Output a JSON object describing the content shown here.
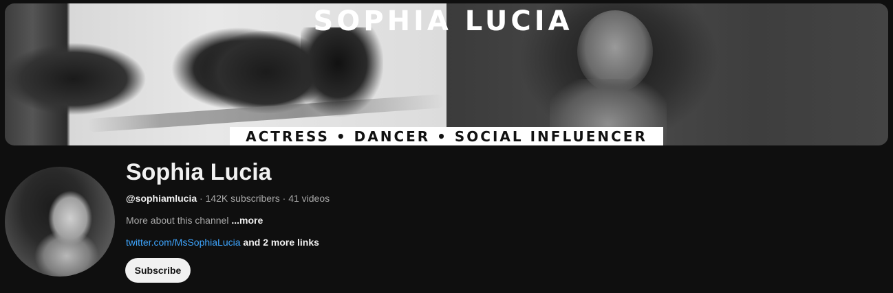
{
  "banner": {
    "title": "SOPHIA LUCIA",
    "tagline": "ACTRESS • DANCER • SOCIAL INFLUENCER"
  },
  "channel": {
    "name": "Sophia Lucia",
    "handle": "@sophiamlucia",
    "separator_1": " · ",
    "subscribers": "142K subscribers",
    "separator_2": " · ",
    "videos": "41 videos",
    "about_text": "More about this channel ",
    "about_more": "...more",
    "link_text": "twitter.com/MsSophiaLucia",
    "more_links": " and 2 more links"
  },
  "actions": {
    "subscribe_label": "Subscribe"
  }
}
